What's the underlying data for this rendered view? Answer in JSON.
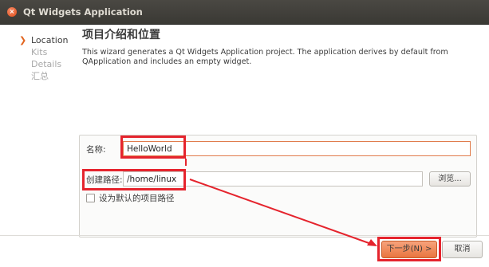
{
  "window": {
    "title": "Qt Widgets Application"
  },
  "sidebar": {
    "items": [
      {
        "label": "Location",
        "active": true
      },
      {
        "label": "Kits",
        "active": false
      },
      {
        "label": "Details",
        "active": false
      },
      {
        "label": "汇总",
        "active": false
      }
    ]
  },
  "main": {
    "title": "项目介绍和位置",
    "description": "This wizard generates a Qt Widgets Application project. The application derives by default from QApplication and includes an empty widget."
  },
  "form": {
    "name_label": "名称:",
    "name_value": "HelloWorld",
    "path_label": "创建路径:",
    "path_value": "/home/linux",
    "browse_label": "浏览...",
    "default_path_label": "设为默认的项目路径",
    "default_path_checked": false
  },
  "buttons": {
    "next_label": "下一步(N) >",
    "cancel_label": "取消"
  },
  "colors": {
    "accent": "#e9753f",
    "annotation": "#e5242d",
    "titlebar": "#3c3b37"
  }
}
